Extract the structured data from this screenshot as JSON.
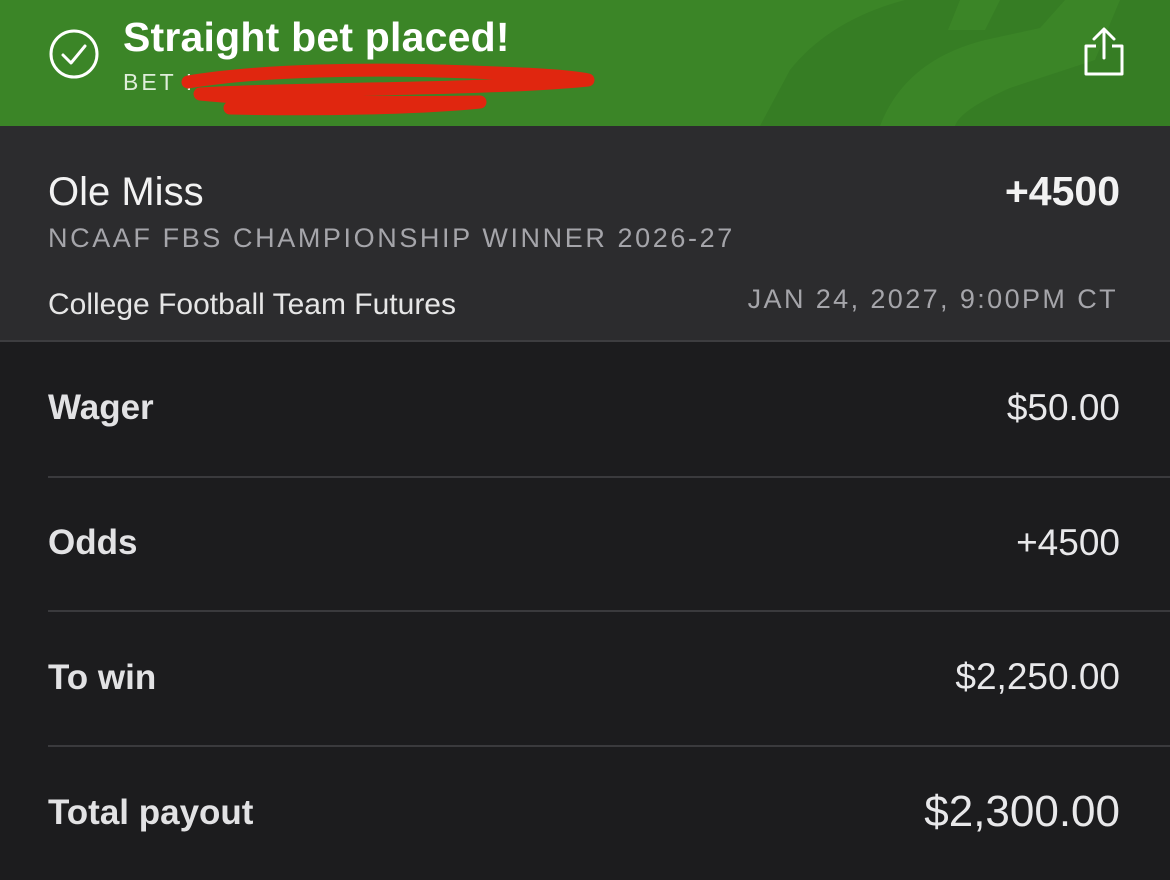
{
  "header": {
    "title": "Straight bet placed!",
    "bet_id_label": "BET I",
    "background_color": "#3b8527"
  },
  "selection": {
    "team": "Ole Miss",
    "odds": "+4500",
    "market": "NCAAF FBS CHAMPIONSHIP WINNER 2026-27",
    "category": "College Football Team Futures",
    "event_time": "JAN 24, 2027, 9:00PM CT"
  },
  "summary": {
    "wager_label": "Wager",
    "wager_value": "$50.00",
    "odds_label": "Odds",
    "odds_value": "+4500",
    "to_win_label": "To win",
    "to_win_value": "$2,250.00",
    "total_payout_label": "Total payout",
    "total_payout_value": "$2,300.00"
  },
  "icons": {
    "status": "check-circle-icon",
    "share": "share-icon"
  },
  "colors": {
    "success_green": "#3b8527",
    "card_background": "#2c2c2e",
    "page_background": "#1c1c1e",
    "redaction_red": "#e0260f"
  }
}
